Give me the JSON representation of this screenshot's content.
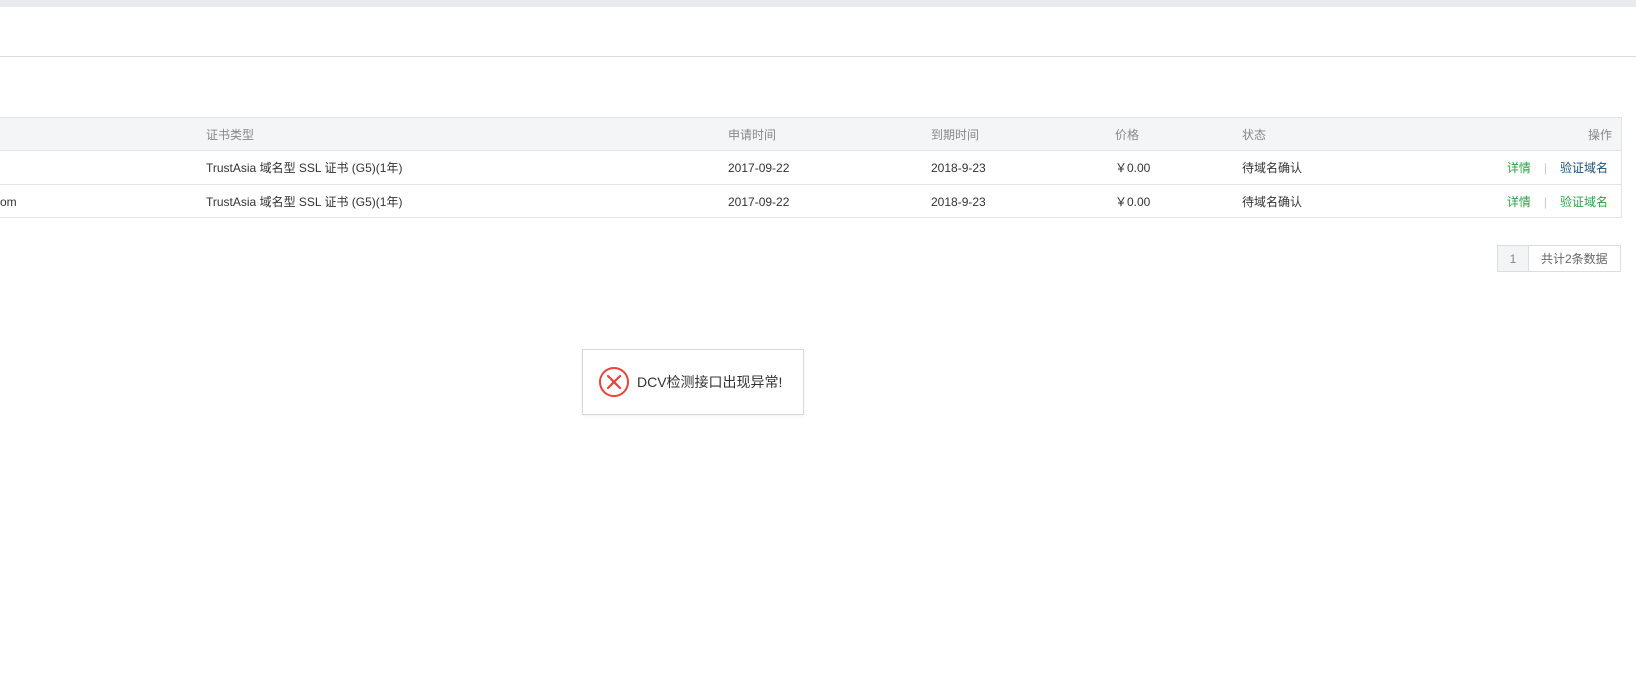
{
  "table": {
    "headers": {
      "cert_type": "证书类型",
      "apply_time": "申请时间",
      "expire_time": "到期时间",
      "price": "价格",
      "status": "状态",
      "ops": "操作"
    },
    "rows": [
      {
        "name": "",
        "cert_type": "TrustAsia 域名型 SSL 证书 (G5)(1年)",
        "apply_time": "2017-09-22",
        "expire_time": "2018-9-23",
        "price": "￥0.00",
        "status": "待域名确认",
        "op_detail": "详情",
        "op_sep": "|",
        "op_verify": "验证域名"
      },
      {
        "name": "om",
        "cert_type": "TrustAsia 域名型 SSL 证书 (G5)(1年)",
        "apply_time": "2017-09-22",
        "expire_time": "2018-9-23",
        "price": "￥0.00",
        "status": "待域名确认",
        "op_detail": "详情",
        "op_sep": "|",
        "op_verify": "验证域名"
      }
    ]
  },
  "pager": {
    "current_page": "1",
    "total_text": "共计2条数据"
  },
  "toast": {
    "icon": "error-circle-icon",
    "message": "DCV检测接口出现异常!",
    "icon_color": "#e8433c"
  },
  "colors": {
    "link_green": "#2ba245",
    "link_dark": "#1b4f72",
    "header_bg": "#f4f5f7"
  }
}
